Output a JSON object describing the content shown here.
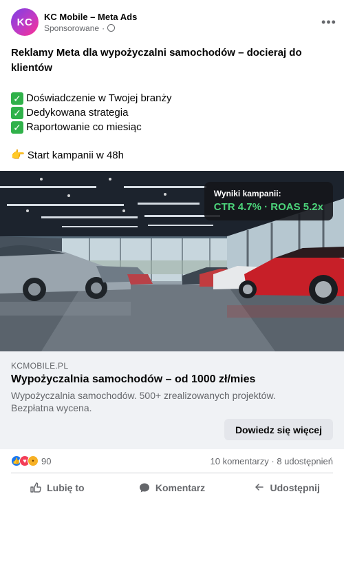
{
  "header": {
    "avatar_initials": "KC",
    "page_name": "KC Mobile – Meta Ads",
    "sponsored_label": "Sponsorowane",
    "separator": "·",
    "more_icon": "more-dots-icon",
    "globe_icon": "globe-icon"
  },
  "post": {
    "title": "Reklamy Meta dla wypożyczalni samochodów – docieraj do klientów",
    "bullets": [
      "Doświadczenie w Twojej branży",
      "Dedykowana strategia",
      "Raportowanie co miesiąc"
    ],
    "check_icon": "check-mark-icon",
    "cta_line": "Start kampanii w 48h",
    "pointer_icon": "pointing-hand-icon"
  },
  "hero": {
    "badge_title": "Wyniki kampanii:",
    "badge_value": "CTR 4.7% · ROAS 5.2x"
  },
  "link": {
    "domain": "KCMOBILE.PL",
    "title": "Wypożyczalnia samochodów – od 1000 zł/mies",
    "description": "Wypożyczalnia samochodów. 500+ zrealizowanych projektów. Bezpłatna wycena.",
    "cta_label": "Dowiedz się więcej"
  },
  "engagement": {
    "reaction_icons": [
      "like-icon",
      "love-icon",
      "wow-icon"
    ],
    "reaction_count": "90",
    "comments_shares": "10 komentarzy · 8 udostępnień"
  },
  "actions": {
    "like_label": "Lubię to",
    "comment_label": "Komentarz",
    "share_label": "Udostępnij"
  },
  "colors": {
    "accent_green": "#4cd37a",
    "facebook_blue": "#1877f2",
    "link_box_bg": "#f0f2f5"
  }
}
